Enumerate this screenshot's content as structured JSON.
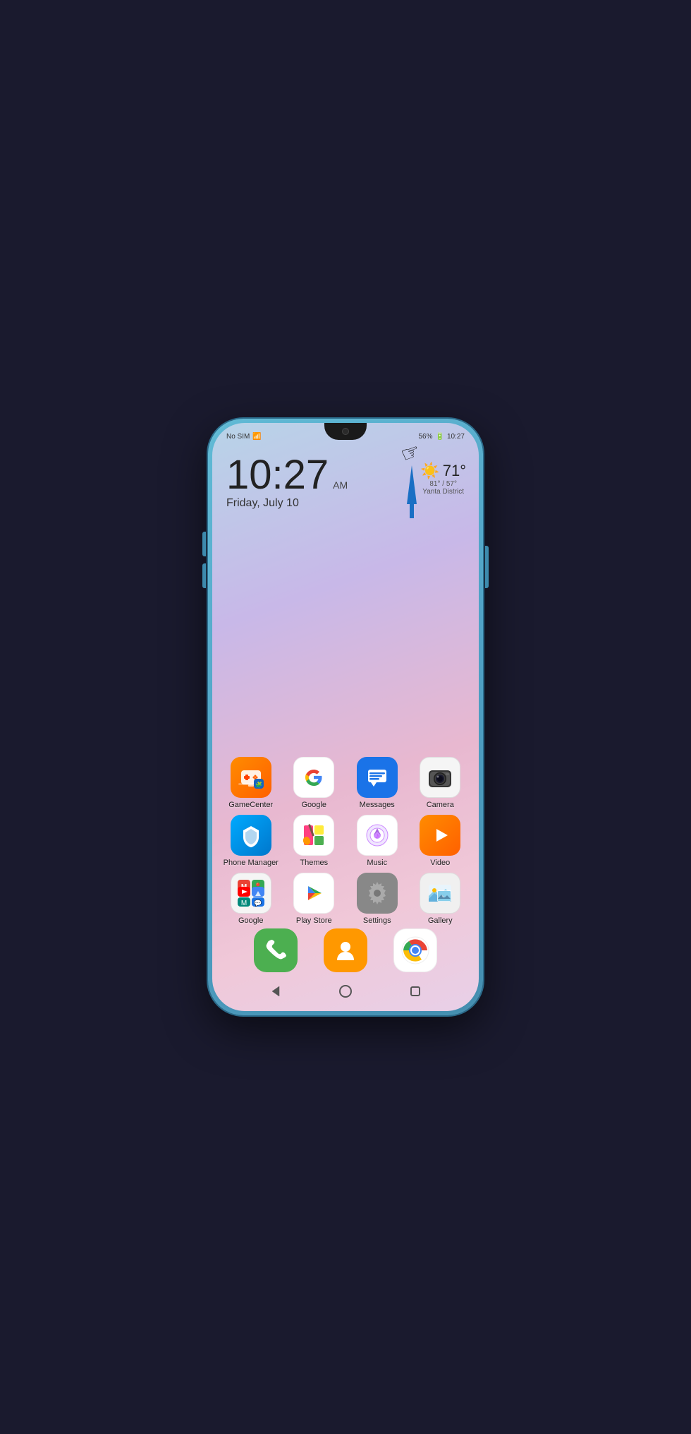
{
  "phone": {
    "status_bar": {
      "left": "No SIM",
      "battery": "56%",
      "time": "10:27"
    },
    "clock": {
      "time": "10:27",
      "am_pm": "AM",
      "date": "Friday, July 10",
      "location": "Yanta District"
    },
    "weather": {
      "temp": "71°",
      "range": "81° / 57°"
    },
    "apps_row1": [
      {
        "id": "gamecenter",
        "label": "GameCenter"
      },
      {
        "id": "google",
        "label": "Google"
      },
      {
        "id": "messages",
        "label": "Messages"
      },
      {
        "id": "camera",
        "label": "Camera"
      }
    ],
    "apps_row2": [
      {
        "id": "phonemanager",
        "label": "Phone Manager"
      },
      {
        "id": "themes",
        "label": "Themes"
      },
      {
        "id": "music",
        "label": "Music"
      },
      {
        "id": "video",
        "label": "Video"
      }
    ],
    "apps_row3": [
      {
        "id": "googlefolder",
        "label": "Google"
      },
      {
        "id": "playstore",
        "label": "Play Store"
      },
      {
        "id": "settings",
        "label": "Settings"
      },
      {
        "id": "gallery",
        "label": "Gallery"
      }
    ],
    "dock": [
      {
        "id": "phone",
        "label": "Phone"
      },
      {
        "id": "contacts",
        "label": "Contacts"
      },
      {
        "id": "chrome",
        "label": "Chrome"
      }
    ],
    "nav": {
      "back": "◁",
      "home": "○",
      "recents": "□"
    },
    "dots": [
      {
        "active": false
      },
      {
        "active": true
      },
      {
        "active": false
      }
    ]
  }
}
